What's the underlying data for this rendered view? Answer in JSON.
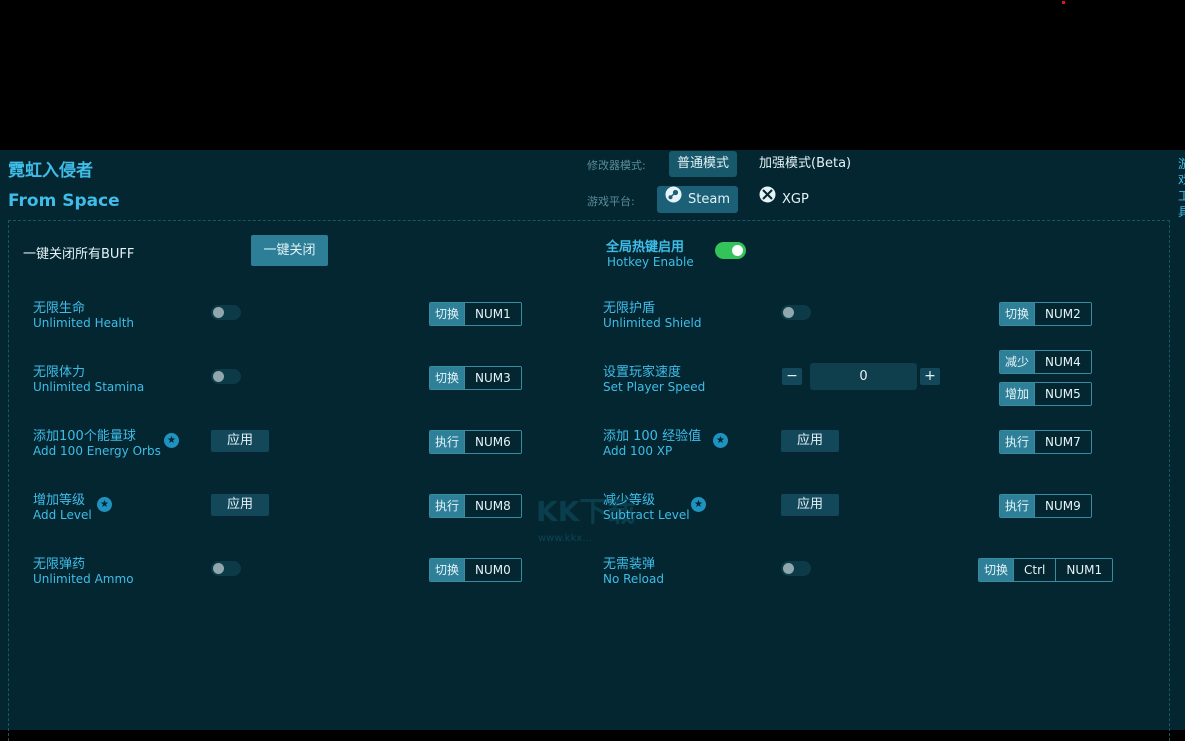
{
  "title_cn": "霓虹入侵者",
  "title_en": "From Space",
  "mode": {
    "label": "修改器模式:",
    "normal": "普通模式",
    "enhanced": "加强模式(Beta)"
  },
  "platform": {
    "label": "游戏平台:",
    "steam": "Steam",
    "xgp": "XGP"
  },
  "edge_text": "游\n戏\n工\n具",
  "buff": {
    "label": "一键关闭所有BUFF",
    "close_button": "一键关闭"
  },
  "hotkey": {
    "cn": "全局热键启用",
    "en": "Hotkey Enable",
    "enabled": true
  },
  "watermark": {
    "main": "KK下载",
    "url": "www.kkx..."
  },
  "rows": [
    {
      "cn": "无限生命",
      "en": "Unlimited Health",
      "action": "切换",
      "keys": [
        "NUM1"
      ]
    },
    {
      "cn": "无限护盾",
      "en": "Unlimited Shield",
      "action": "切换",
      "keys": [
        "NUM2"
      ]
    },
    {
      "cn": "无限体力",
      "en": "Unlimited Stamina",
      "action": "切换",
      "keys": [
        "NUM3"
      ]
    },
    {
      "cn": "设置玩家速度",
      "en": "Set Player Speed",
      "value": "0",
      "dec_action": "减少",
      "dec_key": "NUM4",
      "inc_action": "增加",
      "inc_key": "NUM5"
    },
    {
      "cn": "添加100个能量球",
      "en": "Add 100 Energy Orbs",
      "button": "应用",
      "action": "执行",
      "keys": [
        "NUM6"
      ]
    },
    {
      "cn": "添加 100 经验值",
      "en": "Add 100 XP",
      "button": "应用",
      "action": "执行",
      "keys": [
        "NUM7"
      ]
    },
    {
      "cn": "增加等级",
      "en": "Add Level",
      "button": "应用",
      "action": "执行",
      "keys": [
        "NUM8"
      ]
    },
    {
      "cn": "减少等级",
      "en": "Subtract Level",
      "button": "应用",
      "action": "执行",
      "keys": [
        "NUM9"
      ]
    },
    {
      "cn": "无限弹药",
      "en": "Unlimited Ammo",
      "action": "切换",
      "keys": [
        "NUM0"
      ]
    },
    {
      "cn": "无需装弹",
      "en": "No Reload",
      "action": "切换",
      "keys": [
        "Ctrl",
        "NUM1"
      ]
    }
  ],
  "colors": {
    "accent": "#3fbde8",
    "toggle_on": "#33c35a",
    "background": "#032631"
  }
}
